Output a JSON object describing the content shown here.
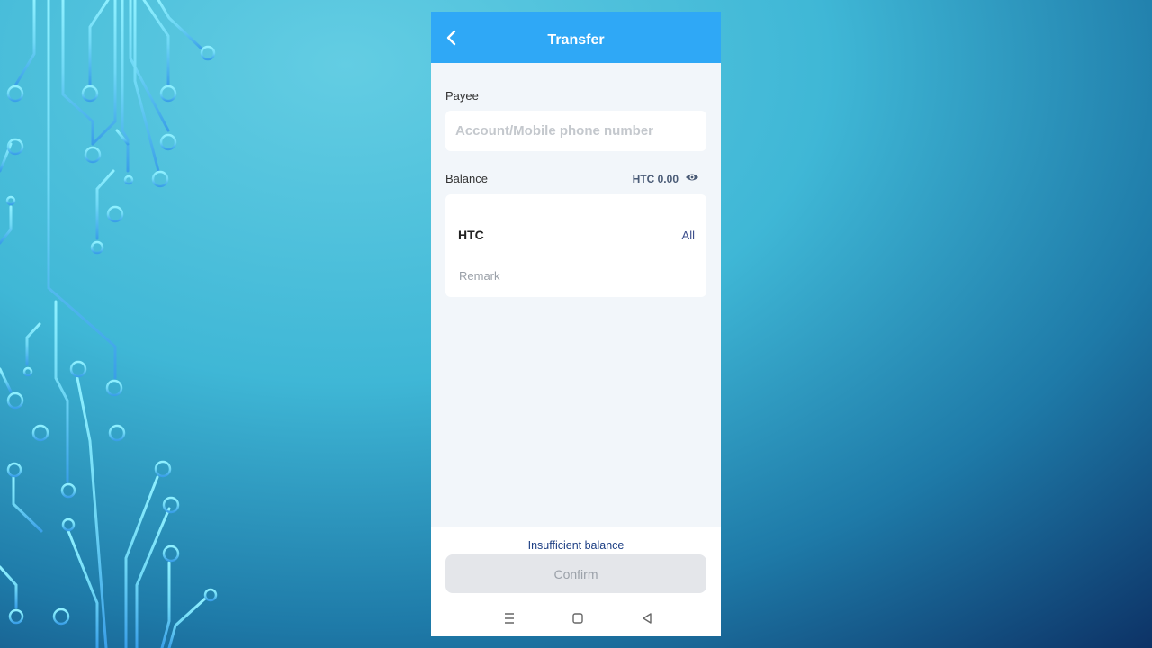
{
  "header": {
    "title": "Transfer",
    "back_icon": "chevron-left-icon"
  },
  "payee": {
    "label": "Payee",
    "placeholder": "Account/Mobile phone number",
    "value": ""
  },
  "balance": {
    "label": "Balance",
    "value": "HTC 0.00",
    "eye_icon": "eye-icon"
  },
  "amount_card": {
    "currency": "HTC",
    "all_label": "All",
    "remark_placeholder": "Remark"
  },
  "footer": {
    "warning": "Insufficient balance",
    "confirm_label": "Confirm",
    "confirm_enabled": false
  },
  "system_nav": {
    "menu_icon": "menu-icon",
    "home_icon": "home-square-icon",
    "back_icon": "back-triangle-icon"
  },
  "colors": {
    "header_bg": "#2fa8f6",
    "warning_text": "#1d3f84",
    "page_bg": "#f2f6fa",
    "disabled_button": "#e4e6ea"
  }
}
